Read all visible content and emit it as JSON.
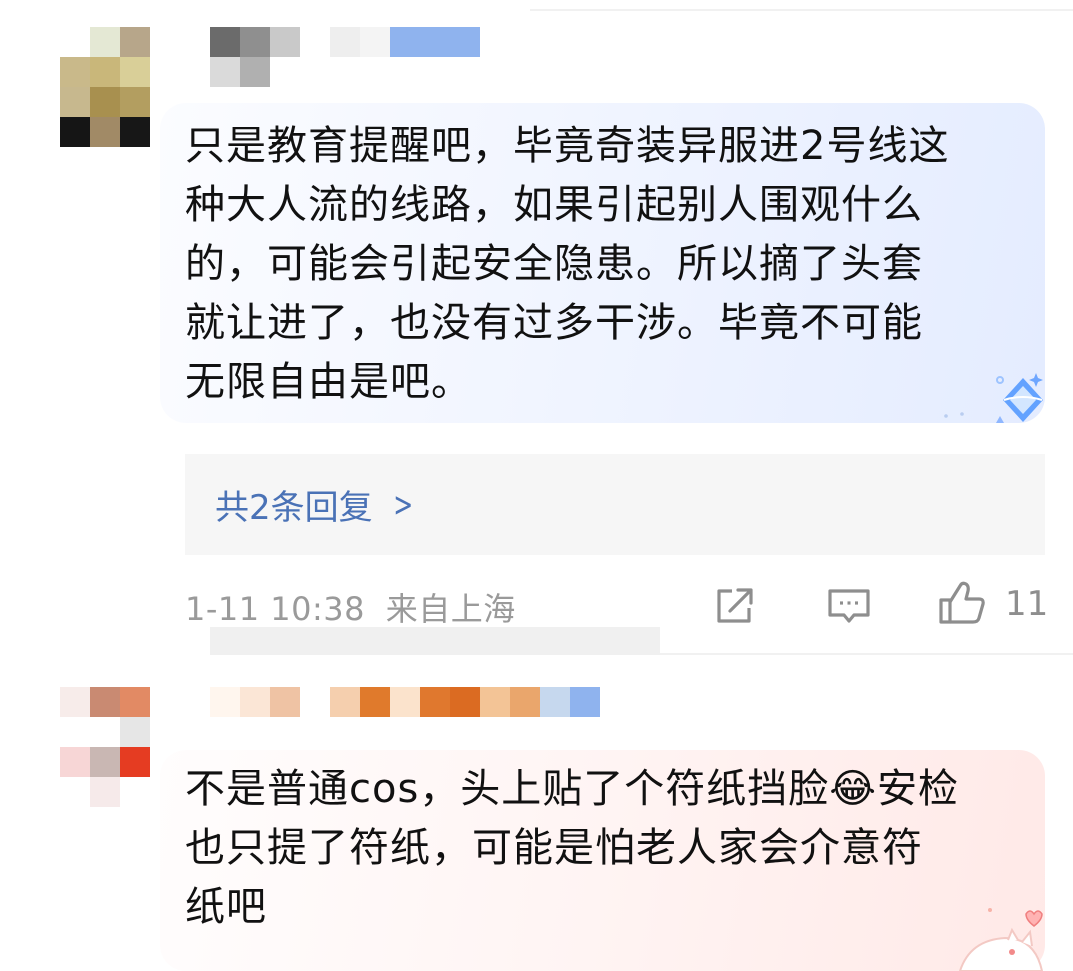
{
  "comments": [
    {
      "text": "只是教育提醒吧，毕竟奇装异服进2号线这\n种大人流的线路，如果引起别人围观什么\n的，可能会引起安全隐患。所以摘了头套\n就让进了，也没有过多干涉。毕竟不可能\n无限自由是吧。",
      "replies_label": "共2条回复",
      "timestamp": "1-11 10:38",
      "location": "来自上海",
      "like_count": "11"
    },
    {
      "text": "不是普通cos，头上贴了个符纸挡脸😂安检\n也只提了符纸，可能是怕老人家会介意符\n纸吧"
    }
  ],
  "icons": {
    "replies_chevron": "chevron-right-icon",
    "share": "share-icon",
    "comment": "comment-icon",
    "like": "thumbs-up-icon",
    "bubble_badge_1": "diamond-badge-icon",
    "bubble_badge_2": "cat-sticker-icon"
  },
  "colors": {
    "link_blue": "#4a72b6",
    "meta_gray": "#9a9a9a",
    "bubble_blue": "#e4ecff",
    "bubble_pink": "#ffe9e7"
  }
}
